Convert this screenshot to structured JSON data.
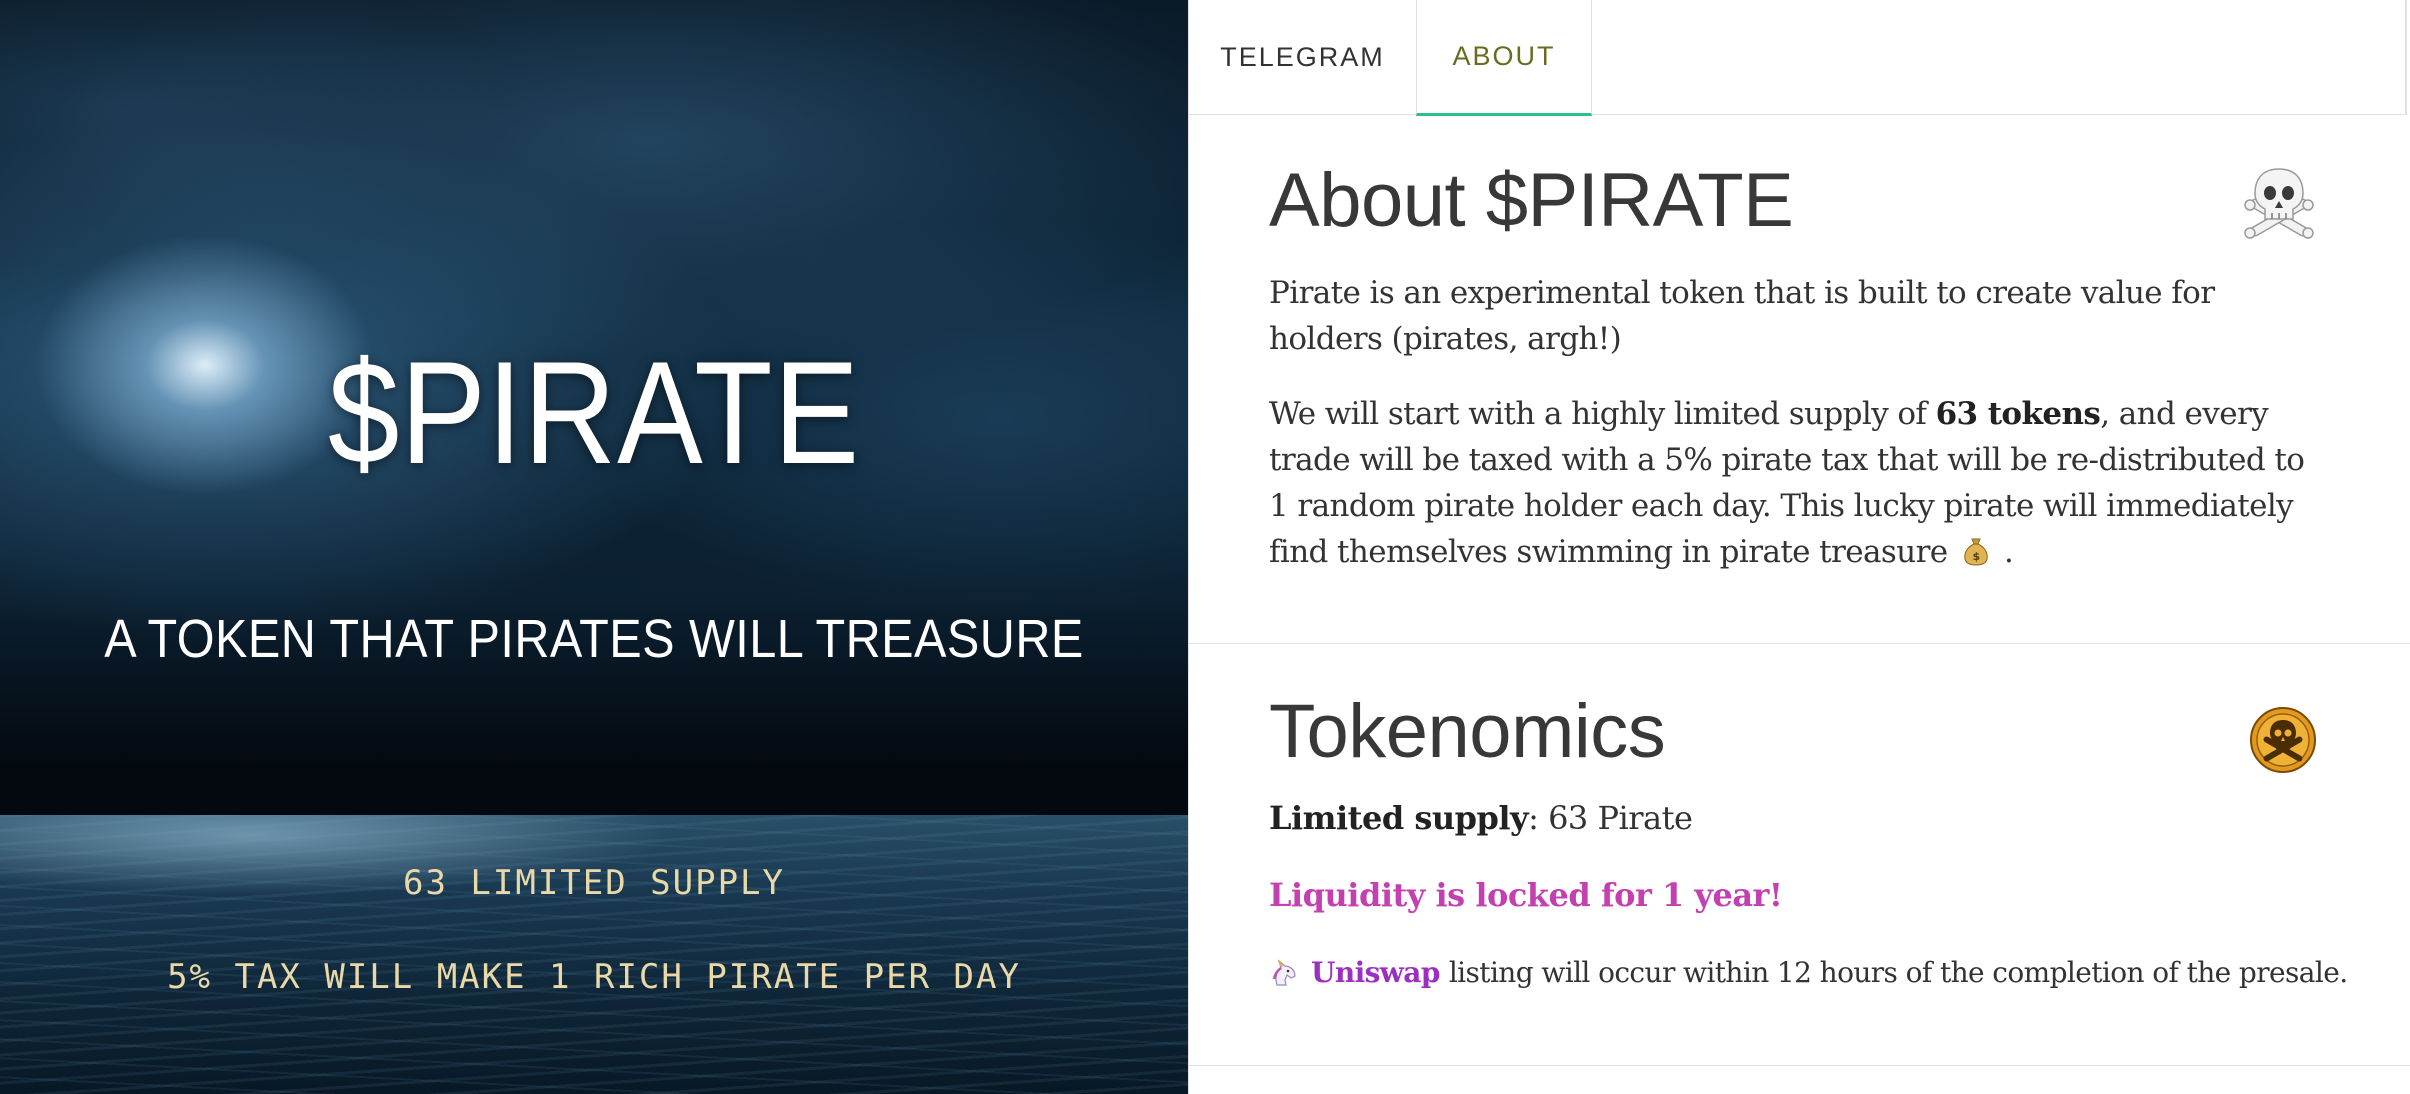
{
  "hero": {
    "title": "$PIRATE",
    "tagline": "A TOKEN THAT PIRATES WILL TREASURE",
    "stat_supply": "63 LIMITED SUPPLY",
    "stat_tax": "5% TAX WILL MAKE 1 RICH PIRATE PER DAY"
  },
  "tabs": [
    {
      "label": "TELEGRAM",
      "active": false
    },
    {
      "label": "ABOUT",
      "active": true
    }
  ],
  "about": {
    "heading": "About $PIRATE",
    "icon": "skull-crossbones-icon",
    "paragraph1": "Pirate is an experimental token that is built to create value for holders (pirates, argh!)",
    "paragraph2_before": "We will start with a highly limited supply of ",
    "paragraph2_bold": "63 tokens",
    "paragraph2_after": ", and every trade will be taxed with a 5% pirate tax that will be re-distributed to 1 random pirate holder each day. This lucky pirate will immediately find themselves swimming in pirate treasure ",
    "paragraph2_end": " ."
  },
  "tokenomics": {
    "heading": "Tokenomics",
    "icon": "pirate-doubloon-icon",
    "supply_label": "Limited supply",
    "supply_value": ": 63 Pirate",
    "locked_text": "Liquidity is locked for 1 year!",
    "listing_link": "Uniswap",
    "listing_text": "listing will occur within 12 hours of the completion of the presale."
  },
  "colors": {
    "tab_active_text": "#6b6b1f",
    "tab_active_border": "#2ebf8f",
    "locked_text": "#c43fb0",
    "uniswap_link": "#9b2fc0",
    "hero_stat_text": "#ead9a8"
  }
}
